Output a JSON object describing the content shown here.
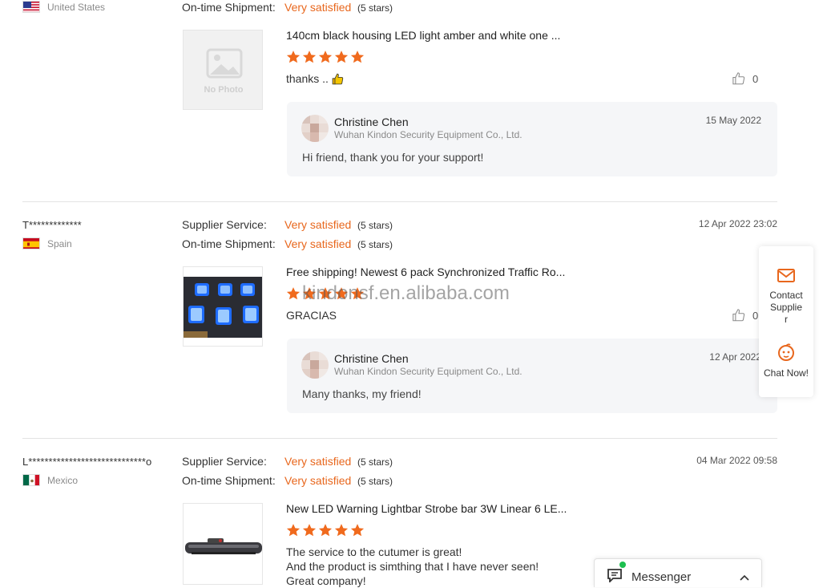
{
  "colors": {
    "accent": "#e8671d",
    "star": "#f06a1d"
  },
  "reviews": [
    {
      "country": "United States",
      "shipment_label": "On-time Shipment:",
      "shipment_value": "Very satisfied",
      "shipment_stars": "(5 stars)",
      "product_title": "140cm black housing LED light amber and white one ...",
      "no_photo_text": "No Photo",
      "review_text": "thanks ..",
      "likes": "0",
      "reply": {
        "name": "Christine Chen",
        "company": "Wuhan Kindon Security Equipment Co., Ltd.",
        "date": "15 May 2022",
        "text": "Hi friend, thank you for your support!"
      }
    },
    {
      "user": "T*************",
      "country": "Spain",
      "datetime": "12 Apr 2022 23:02",
      "supplier_label": "Supplier Service:",
      "supplier_value": "Very satisfied",
      "supplier_stars": "(5 stars)",
      "shipment_label": "On-time Shipment:",
      "shipment_value": "Very satisfied",
      "shipment_stars": "(5 stars)",
      "product_title": "Free shipping! Newest 6 pack Synchronized Traffic Ro...",
      "review_text": "GRACIAS",
      "likes": "0",
      "reply": {
        "name": "Christine Chen",
        "company": "Wuhan Kindon Security Equipment Co., Ltd.",
        "date": "12 Apr 2022",
        "text": "Many thanks, my friend!"
      }
    },
    {
      "user": "L*****************************o",
      "country": "Mexico",
      "datetime": "04 Mar 2022 09:58",
      "supplier_label": "Supplier Service:",
      "supplier_value": "Very satisfied",
      "supplier_stars": "(5 stars)",
      "shipment_label": "On-time Shipment:",
      "shipment_value": "Very satisfied",
      "shipment_stars": "(5 stars)",
      "product_title": "New LED Warning Lightbar Strobe bar 3W Linear 6 LE...",
      "review_lines": [
        "The service to the cutumer is great!",
        "And the product is simthing that I have never seen!",
        "Great company!"
      ]
    }
  ],
  "watermark": "kindonsf.en.alibaba.com",
  "float_panel": {
    "contact_label": "Contact Supplier",
    "chat_label": "Chat Now!"
  },
  "messenger": {
    "label": "Messenger"
  }
}
